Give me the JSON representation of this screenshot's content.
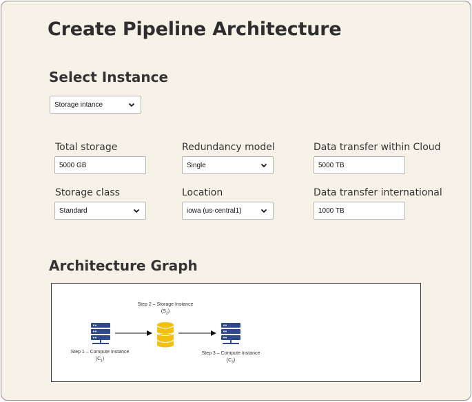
{
  "page": {
    "title": "Create Pipeline Architecture"
  },
  "select_instance": {
    "heading": "Select Instance",
    "instance_select": {
      "value": "Storage intance"
    }
  },
  "config": {
    "total_storage": {
      "label": "Total storage",
      "value": "5000 GB"
    },
    "redundancy_model": {
      "label": "Redundancy model",
      "value": "Single"
    },
    "transfer_within_cloud": {
      "label": "Data transfer within Cloud",
      "value": "5000 TB"
    },
    "storage_class": {
      "label": "Storage class",
      "value": "Standard"
    },
    "location": {
      "label": "Location",
      "value": "iowa (us-central1)"
    },
    "transfer_international": {
      "label": "Data transfer international",
      "value": "1000 TB"
    }
  },
  "architecture": {
    "heading": "Architecture Graph",
    "nodes": [
      {
        "step": "Step 1 – Compute Instance",
        "symbol": "C",
        "sub": "1",
        "icon": "server-icon",
        "color": "#2f4a8a"
      },
      {
        "step": "Step 2 – Storage Instance",
        "symbol": "S",
        "sub": "2",
        "icon": "database-icon",
        "color": "#f2c10f"
      },
      {
        "step": "Step 3 – Compute Instance",
        "symbol": "C",
        "sub": "3",
        "icon": "server-icon",
        "color": "#2f4a8a"
      }
    ]
  },
  "colors": {
    "background": "#f7f2e8",
    "panel_border": "#3a3a3a",
    "server": "#2f4a8a",
    "storage": "#f2c10f"
  }
}
